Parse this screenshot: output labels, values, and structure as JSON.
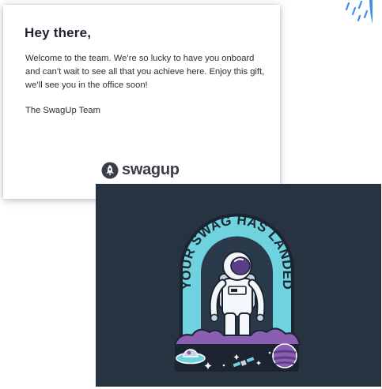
{
  "note": {
    "greeting": "Hey there,",
    "message": "Welcome to the team. We’re so lucky to have you onboard and can’t wait to see all that you achieve here. Enjoy this gift, we’ll see you in the office soon!",
    "signature": "The SwagUp Team",
    "brand": "swagup",
    "brand_icon": "rocket-icon"
  },
  "postcard": {
    "badge_text": "YOUR SWAG HAS LANDED",
    "badge_icon": "astronaut-icon"
  },
  "colors": {
    "postcard_bg": "#273341",
    "badge_teal": "#6ed3df",
    "badge_purple": "#8a5fb3",
    "badge_outline": "#1c2430",
    "text_dark": "#1f2230",
    "rain_blue": "#3f8fe6"
  }
}
